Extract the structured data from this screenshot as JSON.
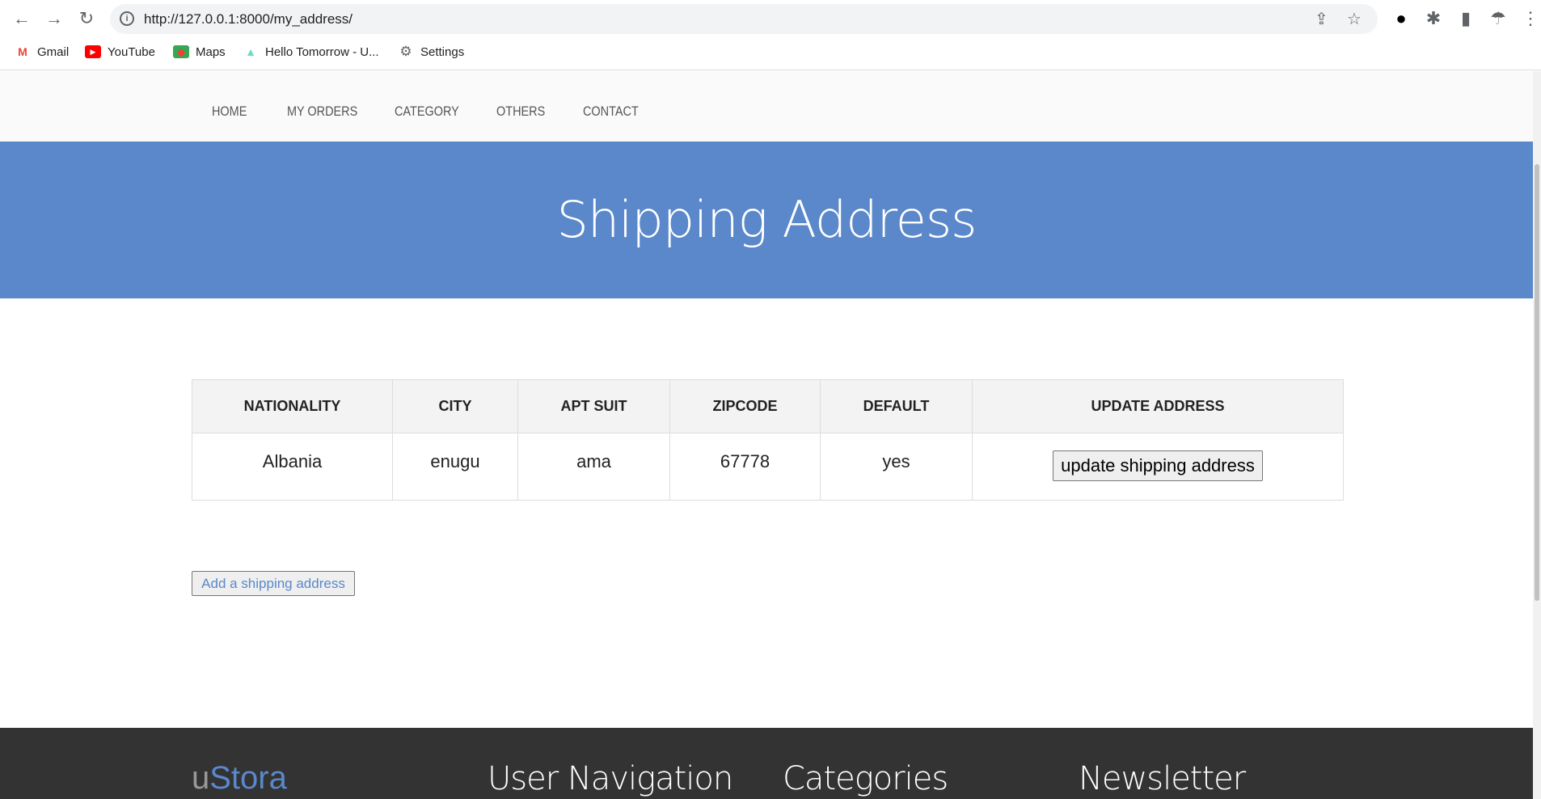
{
  "browser": {
    "url": "http://127.0.0.1:8000/my_address/",
    "bookmarks": [
      {
        "label": "Gmail",
        "icon": "gmail-icon"
      },
      {
        "label": "YouTube",
        "icon": "youtube-icon"
      },
      {
        "label": "Maps",
        "icon": "maps-icon"
      },
      {
        "label": "Hello Tomorrow - U...",
        "icon": "hello-tomorrow-icon"
      },
      {
        "label": "Settings",
        "icon": "gear-icon"
      }
    ]
  },
  "nav": {
    "items": [
      "HOME",
      "MY ORDERS",
      "CATEGORY",
      "OTHERS",
      "CONTACT"
    ]
  },
  "banner": {
    "title": "Shipping Address"
  },
  "table": {
    "headers": [
      "NATIONALITY",
      "CITY",
      "APT SUIT",
      "ZIPCODE",
      "DEFAULT",
      "UPDATE ADDRESS"
    ],
    "rows": [
      {
        "nationality": "Albania",
        "city": "enugu",
        "apt_suit": "ama",
        "zipcode": "67778",
        "default": "yes",
        "action": "update shipping address"
      }
    ]
  },
  "add_button": "Add a shipping address",
  "footer": {
    "brand_prefix": "u",
    "brand_main": "Stora",
    "headings": [
      "User Navigation",
      "Categories",
      "Newsletter"
    ]
  },
  "colors": {
    "accent": "#5a88ca",
    "footer": "#333333"
  }
}
